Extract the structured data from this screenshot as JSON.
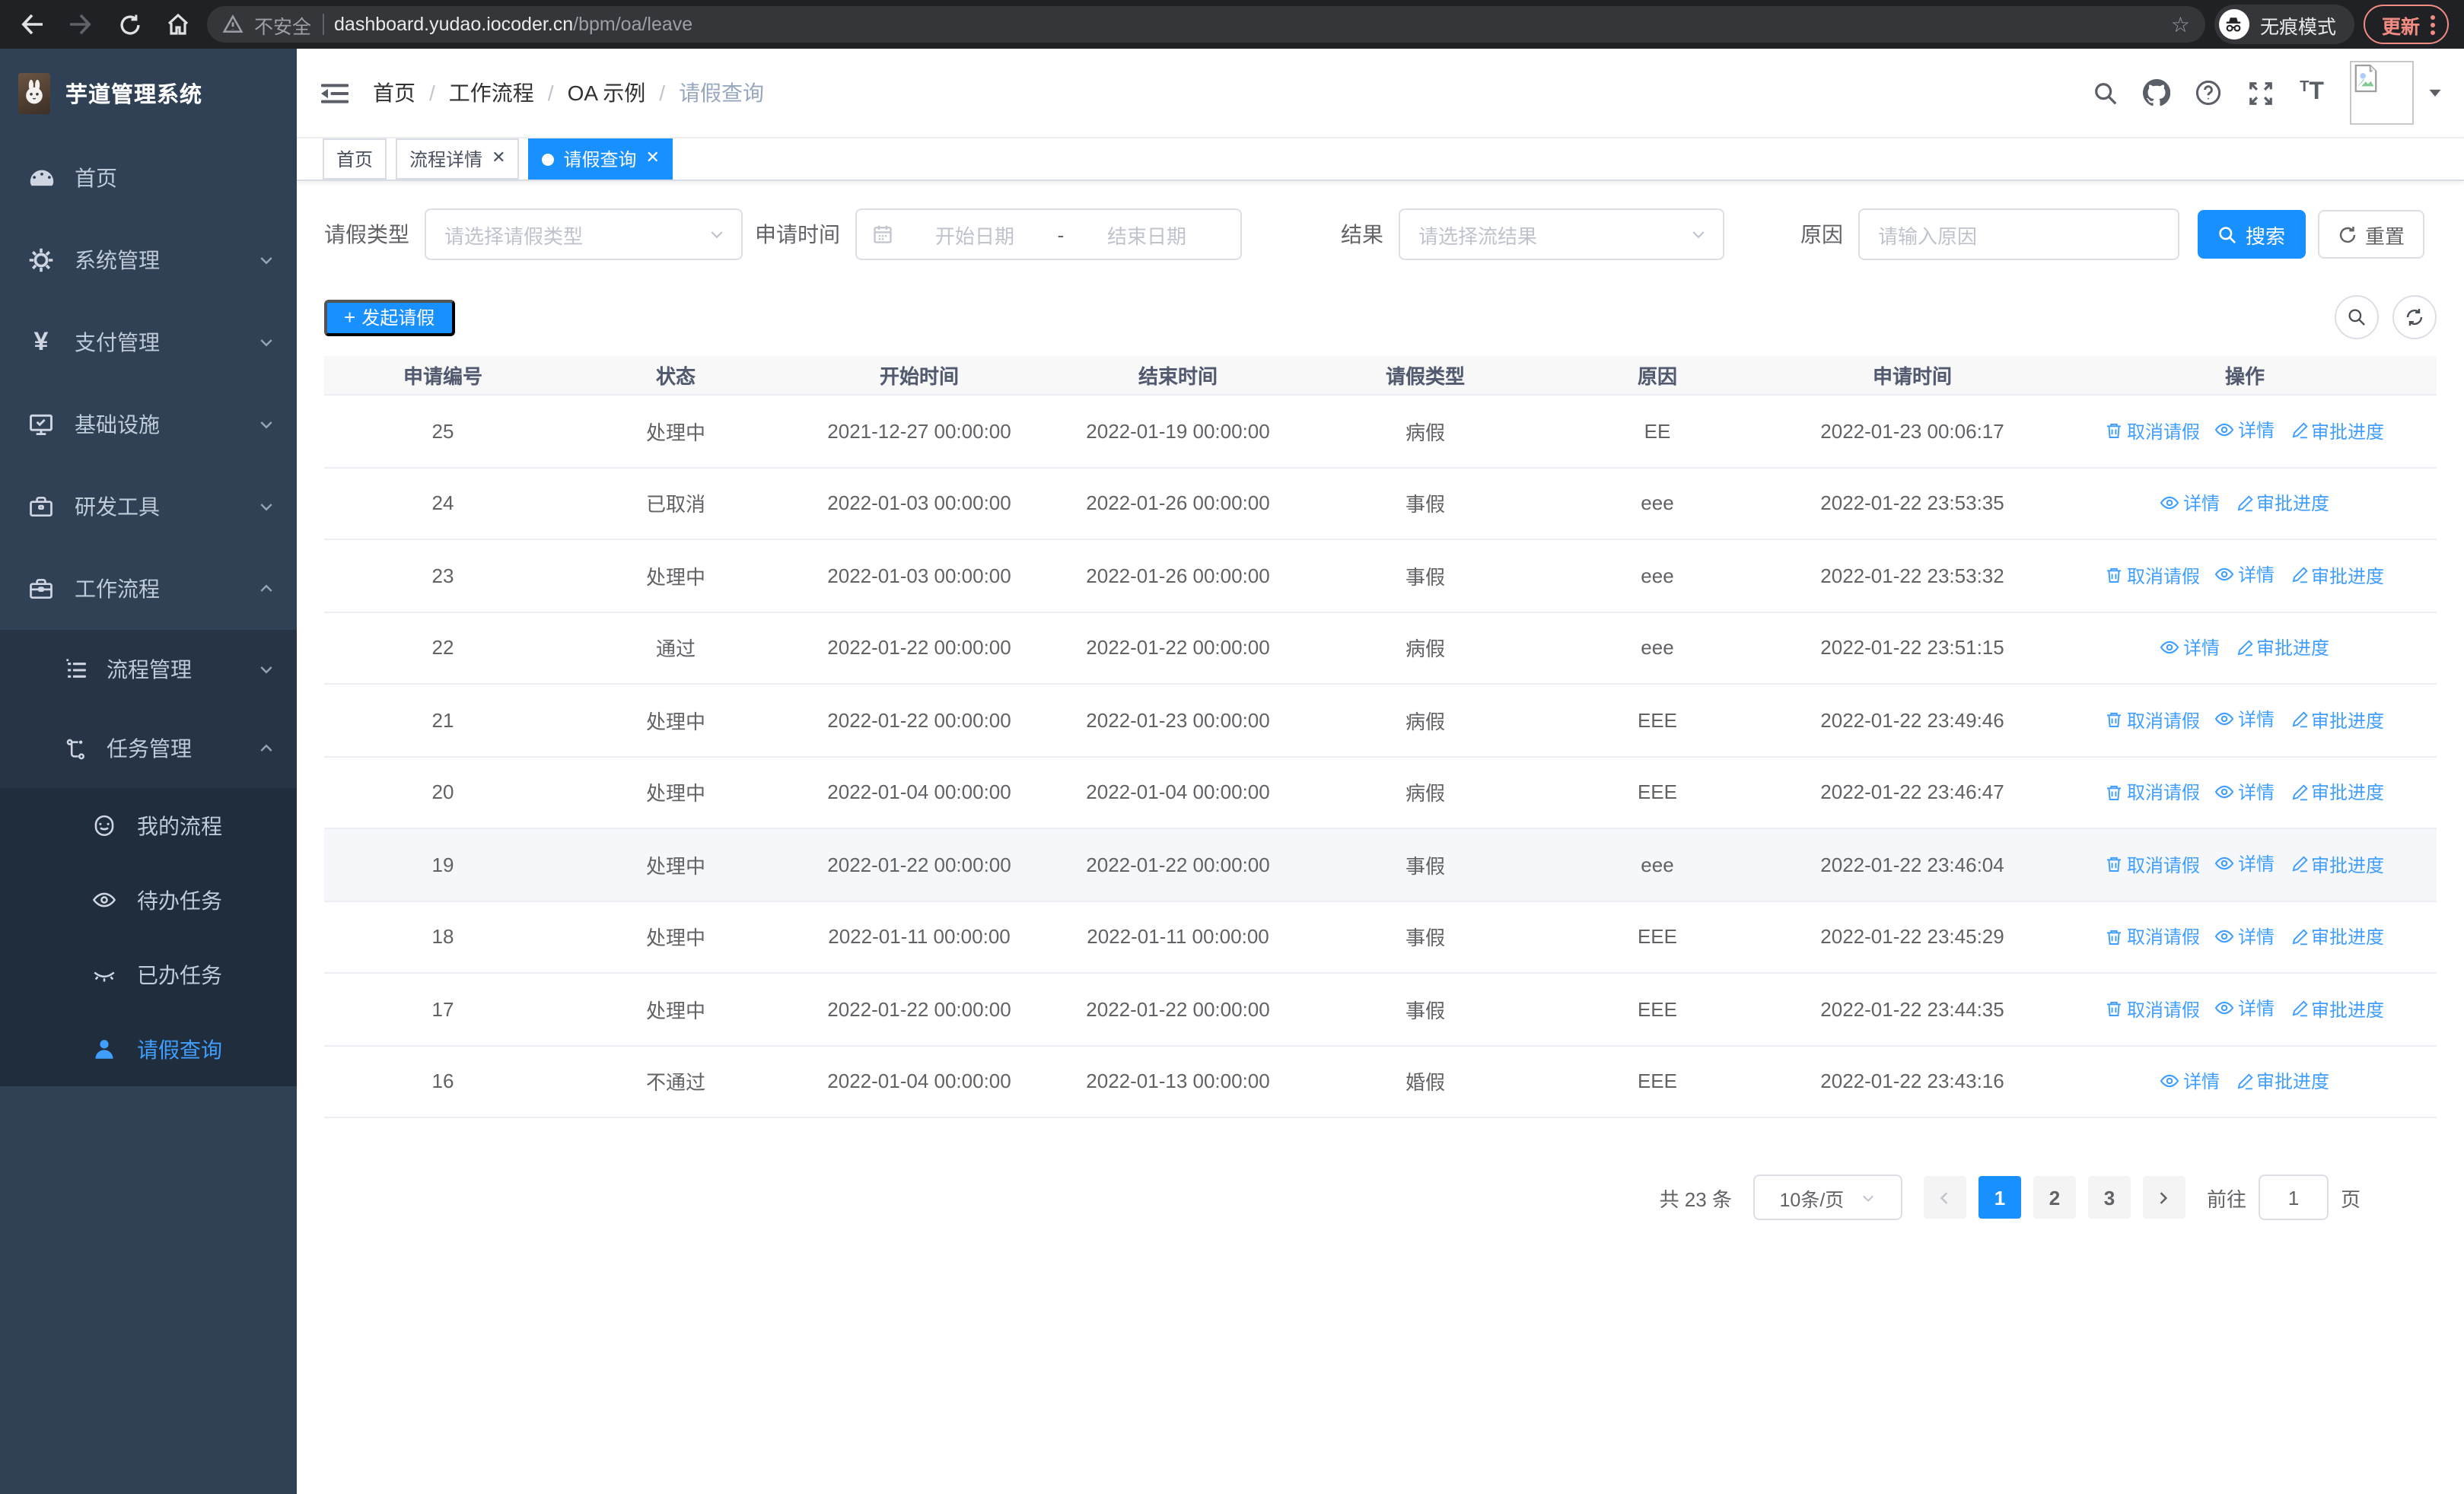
{
  "browser": {
    "security_label": "不安全",
    "url_host": "dashboard.yudao.iocoder.cn",
    "url_path": "/bpm/oa/leave",
    "incognito_label": "无痕模式",
    "update_label": "更新"
  },
  "sidebar": {
    "app_title": "芋道管理系统",
    "items": [
      {
        "label": "首页",
        "icon": "dashboard-icon"
      },
      {
        "label": "系统管理",
        "icon": "gear-icon",
        "state": "collapsed"
      },
      {
        "label": "支付管理",
        "icon": "yuan-icon",
        "state": "collapsed"
      },
      {
        "label": "基础设施",
        "icon": "monitor-icon",
        "state": "collapsed"
      },
      {
        "label": "研发工具",
        "icon": "toolbox-icon",
        "state": "collapsed"
      },
      {
        "label": "工作流程",
        "icon": "briefcase-icon",
        "state": "expanded"
      }
    ],
    "submenu": [
      {
        "label": "流程管理",
        "icon": "list-tree-icon",
        "state": "collapsed"
      },
      {
        "label": "任务管理",
        "icon": "flow-icon",
        "state": "expanded"
      }
    ],
    "leaves": [
      {
        "label": "我的流程",
        "icon": "robot-icon",
        "active": false
      },
      {
        "label": "待办任务",
        "icon": "eye-open-icon",
        "active": false
      },
      {
        "label": "已办任务",
        "icon": "eye-closed-icon",
        "active": false
      },
      {
        "label": "请假查询",
        "icon": "user-icon",
        "active": true
      }
    ]
  },
  "header": {
    "breadcrumb": [
      "首页",
      "工作流程",
      "OA 示例",
      "请假查询"
    ]
  },
  "tabs": [
    {
      "label": "首页",
      "closable": false,
      "active": false
    },
    {
      "label": "流程详情",
      "closable": true,
      "active": false
    },
    {
      "label": "请假查询",
      "closable": true,
      "active": true
    }
  ],
  "filters": {
    "leave_type_label": "请假类型",
    "leave_type_placeholder": "请选择请假类型",
    "apply_time_label": "申请时间",
    "start_date_placeholder": "开始日期",
    "range_separator": "-",
    "end_date_placeholder": "结束日期",
    "result_label": "结果",
    "result_placeholder": "请选择流结果",
    "reason_label": "原因",
    "reason_placeholder": "请输入原因",
    "search_label": "搜索",
    "reset_label": "重置"
  },
  "toolbar": {
    "create_label": "发起请假"
  },
  "table": {
    "columns": [
      "申请编号",
      "状态",
      "开始时间",
      "结束时间",
      "请假类型",
      "原因",
      "申请时间",
      "操作"
    ],
    "action_labels": {
      "cancel": "取消请假",
      "detail": "详情",
      "progress": "审批进度"
    },
    "rows": [
      {
        "id": "25",
        "status": "处理中",
        "start": "2021-12-27 00:00:00",
        "end": "2022-01-19 00:00:00",
        "type": "病假",
        "reason": "EE",
        "apply": "2022-01-23 00:06:17",
        "actions": [
          "cancel",
          "detail",
          "progress"
        ],
        "highlight": false
      },
      {
        "id": "24",
        "status": "已取消",
        "start": "2022-01-03 00:00:00",
        "end": "2022-01-26 00:00:00",
        "type": "事假",
        "reason": "eee",
        "apply": "2022-01-22 23:53:35",
        "actions": [
          "detail",
          "progress"
        ],
        "highlight": false
      },
      {
        "id": "23",
        "status": "处理中",
        "start": "2022-01-03 00:00:00",
        "end": "2022-01-26 00:00:00",
        "type": "事假",
        "reason": "eee",
        "apply": "2022-01-22 23:53:32",
        "actions": [
          "cancel",
          "detail",
          "progress"
        ],
        "highlight": false
      },
      {
        "id": "22",
        "status": "通过",
        "start": "2022-01-22 00:00:00",
        "end": "2022-01-22 00:00:00",
        "type": "病假",
        "reason": "eee",
        "apply": "2022-01-22 23:51:15",
        "actions": [
          "detail",
          "progress"
        ],
        "highlight": false
      },
      {
        "id": "21",
        "status": "处理中",
        "start": "2022-01-22 00:00:00",
        "end": "2022-01-23 00:00:00",
        "type": "病假",
        "reason": "EEE",
        "apply": "2022-01-22 23:49:46",
        "actions": [
          "cancel",
          "detail",
          "progress"
        ],
        "highlight": false
      },
      {
        "id": "20",
        "status": "处理中",
        "start": "2022-01-04 00:00:00",
        "end": "2022-01-04 00:00:00",
        "type": "病假",
        "reason": "EEE",
        "apply": "2022-01-22 23:46:47",
        "actions": [
          "cancel",
          "detail",
          "progress"
        ],
        "highlight": false
      },
      {
        "id": "19",
        "status": "处理中",
        "start": "2022-01-22 00:00:00",
        "end": "2022-01-22 00:00:00",
        "type": "事假",
        "reason": "eee",
        "apply": "2022-01-22 23:46:04",
        "actions": [
          "cancel",
          "detail",
          "progress"
        ],
        "highlight": true
      },
      {
        "id": "18",
        "status": "处理中",
        "start": "2022-01-11 00:00:00",
        "end": "2022-01-11 00:00:00",
        "type": "事假",
        "reason": "EEE",
        "apply": "2022-01-22 23:45:29",
        "actions": [
          "cancel",
          "detail",
          "progress"
        ],
        "highlight": false
      },
      {
        "id": "17",
        "status": "处理中",
        "start": "2022-01-22 00:00:00",
        "end": "2022-01-22 00:00:00",
        "type": "事假",
        "reason": "EEE",
        "apply": "2022-01-22 23:44:35",
        "actions": [
          "cancel",
          "detail",
          "progress"
        ],
        "highlight": false
      },
      {
        "id": "16",
        "status": "不通过",
        "start": "2022-01-04 00:00:00",
        "end": "2022-01-13 00:00:00",
        "type": "婚假",
        "reason": "EEE",
        "apply": "2022-01-22 23:43:16",
        "actions": [
          "detail",
          "progress"
        ],
        "highlight": false
      }
    ]
  },
  "pagination": {
    "total_label": "共 23 条",
    "page_size_value": "10条/页",
    "pages": [
      "1",
      "2",
      "3"
    ],
    "active_page": "1",
    "goto_label": "前往",
    "goto_value": "1",
    "page_unit_label": "页"
  },
  "colors": {
    "accent_blue": "#1890ff",
    "link_blue": "#409eff",
    "sidebar_bg": "#304156",
    "submenu_bg": "#263445",
    "leafmenu_bg": "#1f2d3d",
    "update_red": "#f28b82"
  }
}
